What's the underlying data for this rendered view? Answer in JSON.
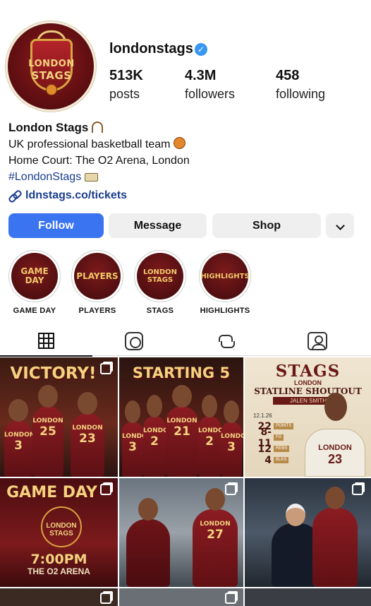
{
  "profile": {
    "username": "londonstags",
    "verified": true,
    "avatar_text_line1": "LONDON",
    "avatar_text_line2": "STAGS",
    "stats": {
      "posts_count": "513K",
      "posts_label": "posts",
      "followers_count": "4.3M",
      "followers_label": "followers",
      "following_count": "458",
      "following_label": "following"
    }
  },
  "bio": {
    "name": "London Stags",
    "line1": "UK professional basketball team",
    "line2": "Home Court: The O2 Arena, London",
    "hashtag": "#LondonStags",
    "link": "ldnstags.co/tickets"
  },
  "actions": {
    "follow_label": "Follow",
    "message_label": "Message",
    "shop_label": "Shop"
  },
  "highlights": [
    {
      "label": "GAME DAY",
      "cover_line1": "GAME",
      "cover_line2": "DAY"
    },
    {
      "label": "PLAYERS",
      "cover_line1": "PLAYERS",
      "cover_line2": ""
    },
    {
      "label": "STAGS",
      "cover_line1": "LONDON",
      "cover_line2": "STAGS"
    },
    {
      "label": "HIGHLIGHTS",
      "cover_line1": "HIGHLIGHTS",
      "cover_line2": ""
    }
  ],
  "tabs": [
    {
      "icon": "grid-icon",
      "active": true
    },
    {
      "icon": "reels-icon",
      "active": false
    },
    {
      "icon": "repost-icon",
      "active": false
    },
    {
      "icon": "tagged-icon",
      "active": false
    }
  ],
  "posts": {
    "p1": {
      "title": "VICTORY!",
      "players": [
        {
          "team": "LONDON",
          "number": "3"
        },
        {
          "team": "LONDON",
          "number": "25"
        },
        {
          "team": "LONDON",
          "number": "23"
        }
      ]
    },
    "p2": {
      "title": "STARTING 5",
      "players": [
        {
          "team": "LONDON",
          "number": "3"
        },
        {
          "team": "LONDON",
          "number": "2"
        },
        {
          "team": "LONDON",
          "number": "21"
        },
        {
          "team": "LONDON",
          "number": "2"
        },
        {
          "team": "LONDON",
          "number": "3"
        }
      ]
    },
    "p3": {
      "title": "STAGS",
      "subtitle": "LONDON",
      "headline": "STATLINE SHOUTOUT",
      "player_name": "JALEN SMITH",
      "date": "12.1.26",
      "stats": [
        {
          "value": "22",
          "label": "POINTS"
        },
        {
          "value": "8-11",
          "label": "FG"
        },
        {
          "value": "12",
          "label": "REBS"
        },
        {
          "value": "4",
          "label": "BLKS"
        }
      ],
      "jersey_team": "LONDON",
      "jersey_number": "23"
    },
    "p4": {
      "title": "GAME DAY",
      "crest_line1": "LONDON",
      "crest_line2": "STAGS",
      "time": "7:00PM",
      "venue": "THE O2 ARENA"
    },
    "p5": {
      "players": [
        {
          "team": "LONDON",
          "number": "27"
        }
      ]
    },
    "p6": {}
  },
  "colors": {
    "follow_button": "#3a74f0",
    "verified_badge": "#3897f0",
    "link": "#1a3d8f",
    "brand_maroon": "#7b1418",
    "brand_gold": "#f4d27f"
  }
}
